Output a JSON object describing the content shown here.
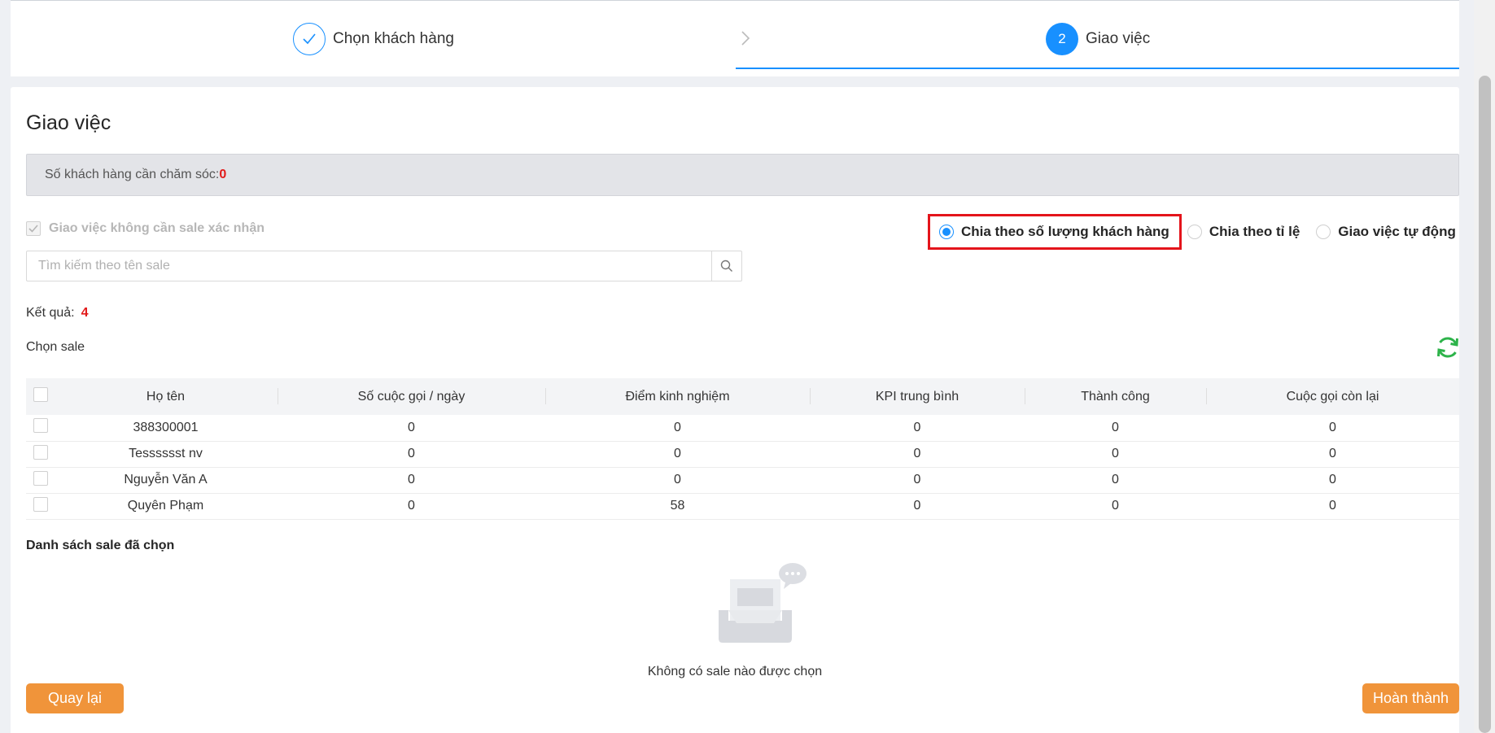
{
  "steps": {
    "step1": {
      "label": "Chọn khách hàng"
    },
    "step2": {
      "number": "2",
      "label": "Giao việc"
    }
  },
  "page": {
    "title": "Giao việc"
  },
  "notice": {
    "text": "Số khách hàng cần chăm sóc:",
    "count": "0"
  },
  "options": {
    "no_confirm_label": "Giao việc không cần sale xác nhận",
    "radios": [
      {
        "label": "Chia theo số lượng khách hàng",
        "selected": true
      },
      {
        "label": "Chia theo tỉ lệ",
        "selected": false
      },
      {
        "label": "Giao việc tự động",
        "selected": false
      }
    ]
  },
  "search": {
    "placeholder": "Tìm kiếm theo tên sale"
  },
  "result": {
    "label": "Kết quả:",
    "count": "4"
  },
  "choose_sale_label": "Chọn sale",
  "table": {
    "headers": [
      "Họ tên",
      "Số cuộc gọi / ngày",
      "Điểm kinh nghiệm",
      "KPI trung bình",
      "Thành công",
      "Cuộc gọi còn lại"
    ],
    "rows": [
      [
        "388300001",
        "0",
        "0",
        "0",
        "0",
        "0"
      ],
      [
        "Tesssssst nv",
        "0",
        "0",
        "0",
        "0",
        "0"
      ],
      [
        "Nguyễn Văn A",
        "0",
        "0",
        "0",
        "0",
        "0"
      ],
      [
        "Quyên Phạm",
        "0",
        "58",
        "0",
        "0",
        "0"
      ]
    ]
  },
  "selected": {
    "title": "Danh sách sale đã chọn",
    "empty_text": "Không có sale nào được chọn"
  },
  "buttons": {
    "back": "Quay lại",
    "done": "Hoàn thành"
  },
  "colors": {
    "primary": "#1890ff",
    "accent": "#f0943a",
    "danger": "#e21a1a",
    "refresh": "#2db34a"
  }
}
